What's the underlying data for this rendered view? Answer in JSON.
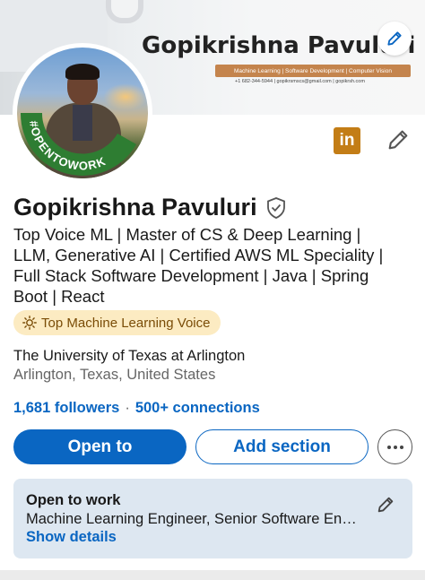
{
  "banner": {
    "name": "Gopikrishna Pavuluri",
    "tagline": "Machine Learning | Software Development | Computer Vision",
    "contact": "+1 682-344-5944  |  gopikrsmscs@gmail.com  |  gopikrsh.com"
  },
  "avatar": {
    "frame_text": "#OPENTOWORK",
    "frame_color": "#2e7d32"
  },
  "profile": {
    "name": "Gopikrishna Pavuluri",
    "headline_lines": [
      "Top Voice ML | Master of CS & Deep Learning |",
      "LLM, Generative AI | Certified AWS ML Speciality |",
      "Full Stack Software Development | Java | Spring",
      "Boot | React"
    ],
    "voice_badge": "Top Machine Learning Voice",
    "school": "The University of Texas at Arlington",
    "location": "Arlington, Texas, United States",
    "followers": "1,681 followers",
    "connections": "500+ connections"
  },
  "actions": {
    "open_to": "Open to",
    "add_section": "Add section"
  },
  "open_to_work": {
    "title": "Open to work",
    "roles": "Machine Learning Engineer, Senior Software Engineer",
    "show_details": "Show details"
  },
  "colors": {
    "brand_blue": "#0a66c2",
    "linkedin_icon": "#c37d16",
    "badge_bg": "#fcebc2",
    "card_bg": "#dde7f1"
  },
  "icons": [
    "pencil-icon",
    "linkedin-icon",
    "verified-shield-icon",
    "sun-icon",
    "more-dots-icon"
  ]
}
